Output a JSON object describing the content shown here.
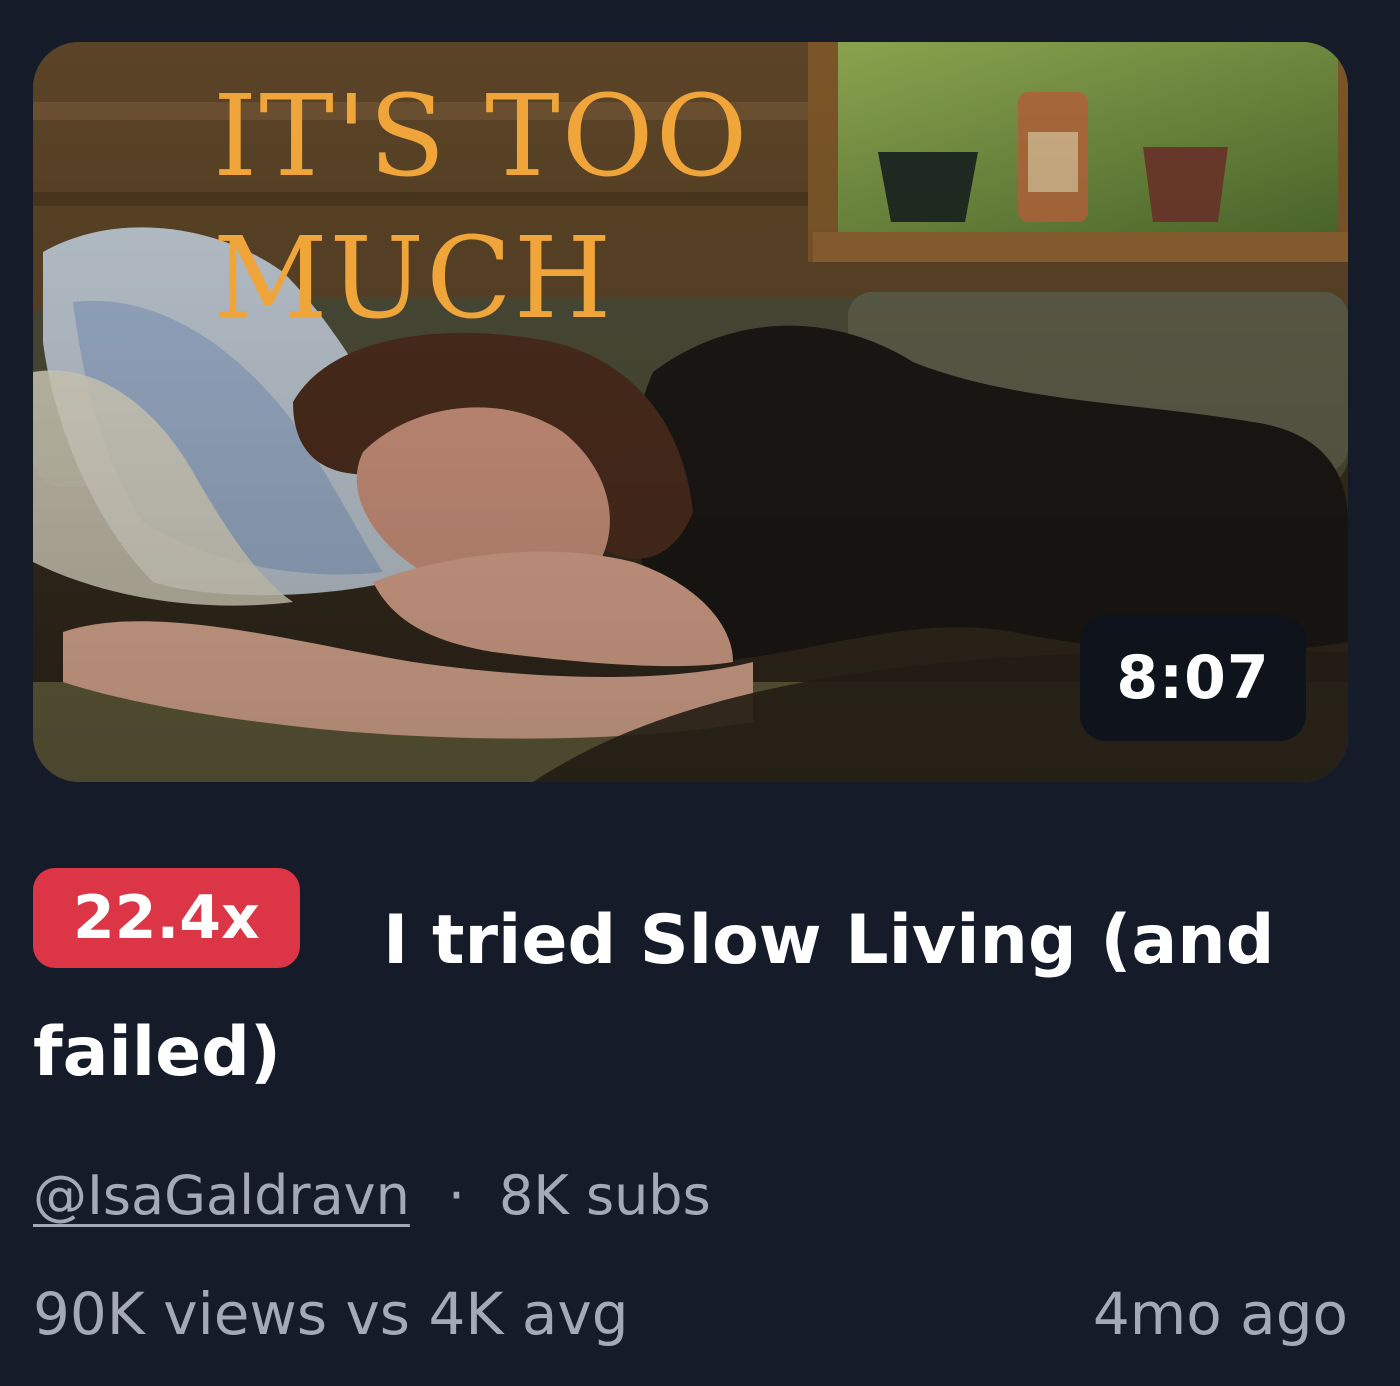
{
  "thumbnail": {
    "overlay_text": "IT'S TOO\nMUCH",
    "duration": "8:07"
  },
  "video": {
    "outlier_badge": "22.4x",
    "title": "I tried Slow Living (and failed)"
  },
  "channel": {
    "handle": "@IsaGaldravn",
    "separator": "·",
    "subscribers": "8K subs"
  },
  "stats": {
    "views_vs_avg": "90K views vs 4K avg",
    "published": "4mo ago"
  },
  "colors": {
    "background": "#151b28",
    "badge": "#dc3545",
    "thumbnail_text": "#f0a53a",
    "muted_text": "#a4a9b6"
  }
}
